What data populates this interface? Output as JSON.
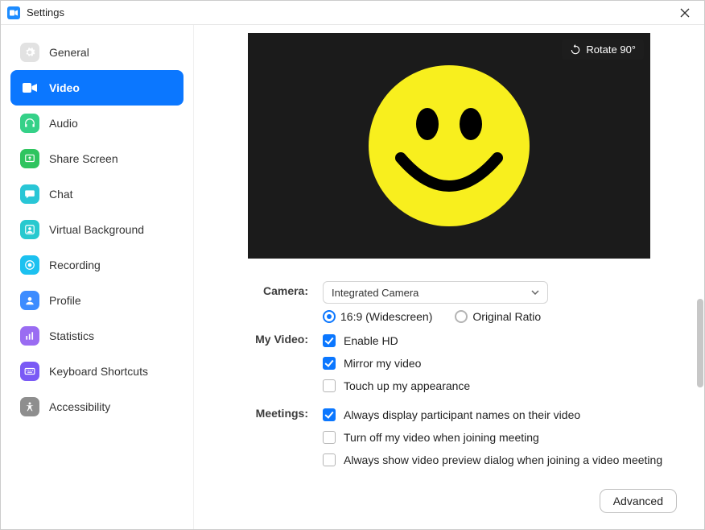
{
  "window": {
    "title": "Settings"
  },
  "sidebar": {
    "items": [
      {
        "label": "General",
        "active": false
      },
      {
        "label": "Video",
        "active": true
      },
      {
        "label": "Audio",
        "active": false
      },
      {
        "label": "Share Screen",
        "active": false
      },
      {
        "label": "Chat",
        "active": false
      },
      {
        "label": "Virtual Background",
        "active": false
      },
      {
        "label": "Recording",
        "active": false
      },
      {
        "label": "Profile",
        "active": false
      },
      {
        "label": "Statistics",
        "active": false
      },
      {
        "label": "Keyboard Shortcuts",
        "active": false
      },
      {
        "label": "Accessibility",
        "active": false
      }
    ]
  },
  "preview": {
    "rotate_label": "Rotate 90°"
  },
  "camera": {
    "label": "Camera:",
    "selected": "Integrated Camera",
    "ratio_options": [
      {
        "label": "16:9 (Widescreen)",
        "checked": true
      },
      {
        "label": "Original Ratio",
        "checked": false
      }
    ]
  },
  "my_video": {
    "label": "My Video:",
    "options": [
      {
        "label": "Enable HD",
        "checked": true
      },
      {
        "label": "Mirror my video",
        "checked": true
      },
      {
        "label": "Touch up my appearance",
        "checked": false
      }
    ]
  },
  "meetings": {
    "label": "Meetings:",
    "options": [
      {
        "label": "Always display participant names on their video",
        "checked": true
      },
      {
        "label": "Turn off my video when joining meeting",
        "checked": false
      },
      {
        "label": "Always show video preview dialog when joining a video meeting",
        "checked": false
      }
    ]
  },
  "footer": {
    "advanced": "Advanced"
  }
}
